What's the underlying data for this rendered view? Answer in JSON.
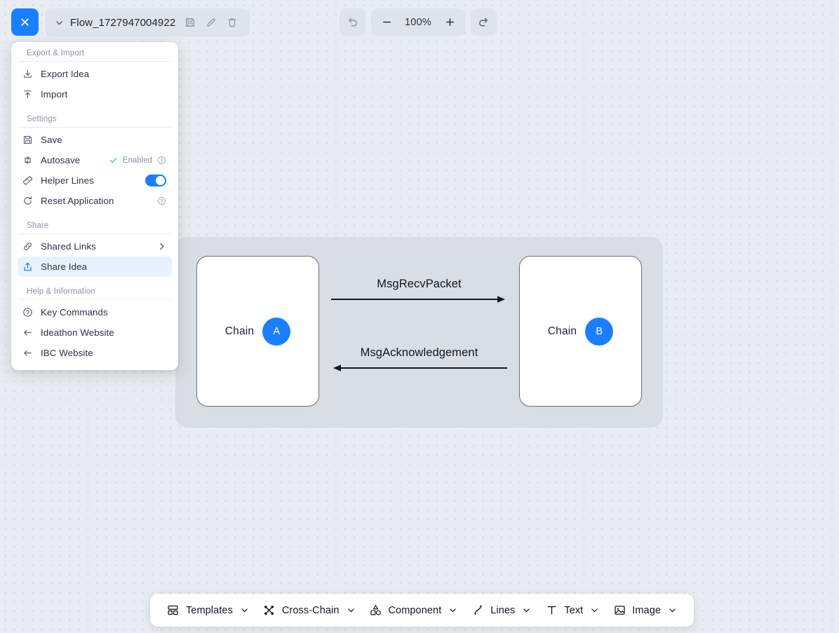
{
  "topbar": {
    "close_button": "close-icon",
    "caret": "chevron-down-icon",
    "flow_title": "Flow_1727947004922",
    "save_icon": "save-disk-icon",
    "edit_icon": "pencil-icon",
    "delete_icon": "trash-icon",
    "undo_icon": "undo-arrow-icon",
    "redo_icon": "redo-arrow-icon",
    "zoom_out": "minus-icon",
    "zoom_in": "plus-icon",
    "zoom_value": "100%"
  },
  "menu": {
    "sections": [
      {
        "label": "Export & Import",
        "items": [
          {
            "label": "Export Idea",
            "icon": "download-icon"
          },
          {
            "label": "Import",
            "icon": "upload-icon"
          }
        ]
      },
      {
        "label": "Settings",
        "items": [
          {
            "label": "Save",
            "icon": "save-disk-icon"
          },
          {
            "label": "Autosave",
            "icon": "loop-arrows-icon",
            "status": "Enabled",
            "help": "help-circle-icon"
          },
          {
            "label": "Helper Lines",
            "icon": "ruler-icon",
            "toggle": "on"
          },
          {
            "label": "Reset Application",
            "icon": "refresh-icon",
            "help": "help-circle-icon"
          }
        ]
      },
      {
        "label": "Share",
        "items": [
          {
            "label": "Shared Links",
            "icon": "link-icon",
            "chevron": "chevron-right-icon"
          },
          {
            "label": "Share Idea",
            "icon": "share-up-icon",
            "active": true
          }
        ]
      },
      {
        "label": "Help & Information",
        "items": [
          {
            "label": "Key Commands",
            "icon": "help-circle-icon"
          },
          {
            "label": "Ideathon Website",
            "icon": "arrow-left-icon"
          },
          {
            "label": "IBC Website",
            "icon": "arrow-left-icon"
          }
        ]
      }
    ]
  },
  "canvas": {
    "nodes": [
      {
        "label": "Chain",
        "badge": "A"
      },
      {
        "label": "Chain",
        "badge": "B"
      }
    ],
    "edges": [
      {
        "label": "MsgRecvPacket",
        "direction": "right"
      },
      {
        "label": "MsgAcknowledgement",
        "direction": "left"
      }
    ]
  },
  "bottom_toolbar": {
    "items": [
      {
        "label": "Templates",
        "icon": "templates-icon"
      },
      {
        "label": "Cross-Chain",
        "icon": "cross-chain-icon"
      },
      {
        "label": "Component",
        "icon": "shapes-icon"
      },
      {
        "label": "Lines",
        "icon": "curve-line-icon"
      },
      {
        "label": "Text",
        "icon": "text-t-icon"
      },
      {
        "label": "Image",
        "icon": "image-icon"
      }
    ]
  },
  "colors": {
    "accent": "#1a7fff",
    "canvas_bg": "#e9ecf2",
    "container_bg": "#d9dde4",
    "success": "#22c55e"
  }
}
